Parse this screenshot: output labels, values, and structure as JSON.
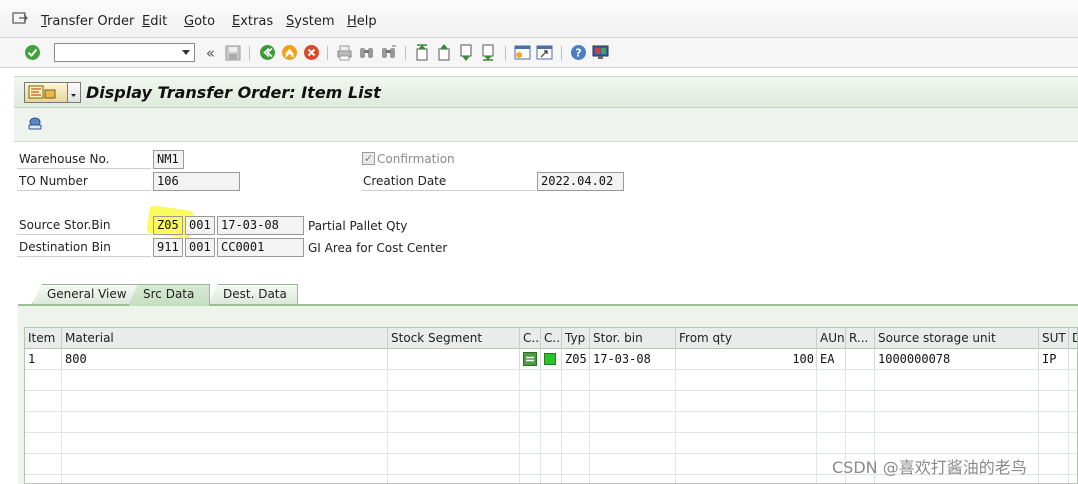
{
  "menu": {
    "items": [
      "Transfer Order",
      "Edit",
      "Goto",
      "Extras",
      "System",
      "Help"
    ]
  },
  "toolbar": {
    "command_field_value": "",
    "icons": [
      "enter-icon",
      "back-icon",
      "save-icon",
      "back-nav-icon",
      "exit-icon",
      "cancel-icon",
      "print-icon",
      "find-icon",
      "find-next-icon",
      "first-page-icon",
      "previous-page-icon",
      "next-page-icon",
      "last-page-icon",
      "new-session-icon",
      "shortcut-icon",
      "help-icon",
      "customize-layout-icon"
    ]
  },
  "title": {
    "text": "Display Transfer Order: Item List"
  },
  "form": {
    "warehouse_label": "Warehouse No.",
    "warehouse_value": "NM1",
    "to_number_label": "TO Number",
    "to_number_value": "106",
    "confirmation_label": "Confirmation",
    "confirmation_checked": true,
    "creation_date_label": "Creation Date",
    "creation_date_value": "2022.04.02",
    "source_bin_label": "Source Stor.Bin",
    "source_type": "Z05",
    "source_section": "001",
    "source_bin": "17-03-08",
    "source_desc": "Partial Pallet Qty",
    "dest_bin_label": "Destination Bin",
    "dest_type": "911",
    "dest_section": "001",
    "dest_bin": "CC0001",
    "dest_desc": "GI Area for Cost Center"
  },
  "tabs": [
    {
      "label": "General View",
      "active": false
    },
    {
      "label": "Src Data",
      "active": true
    },
    {
      "label": "Dest. Data",
      "active": false
    }
  ],
  "table": {
    "columns": [
      "Item",
      "Material",
      "Stock Segment",
      "C..",
      "C..",
      "Typ",
      "Stor. bin",
      "From qty",
      "AUn",
      "R...",
      "Source storage unit",
      "SUT",
      "D"
    ],
    "rows": [
      {
        "item": "1",
        "material": "800",
        "stock_segment": "",
        "typ": "Z05",
        "stor_bin": "17-03-08",
        "from_qty": "100",
        "aun": "EA",
        "r": "",
        "source_storage_unit": "1000000078",
        "sut": "IP"
      }
    ],
    "status_colors": {
      "indicator_1": "#4f9a45",
      "indicator_2": "#2dc12d"
    }
  },
  "watermark": "CSDN @喜欢打酱油的老鸟",
  "colors": {
    "highlight": "#faf628",
    "title_bg": "#e4ede2",
    "tab_accent": "#9bc096"
  }
}
